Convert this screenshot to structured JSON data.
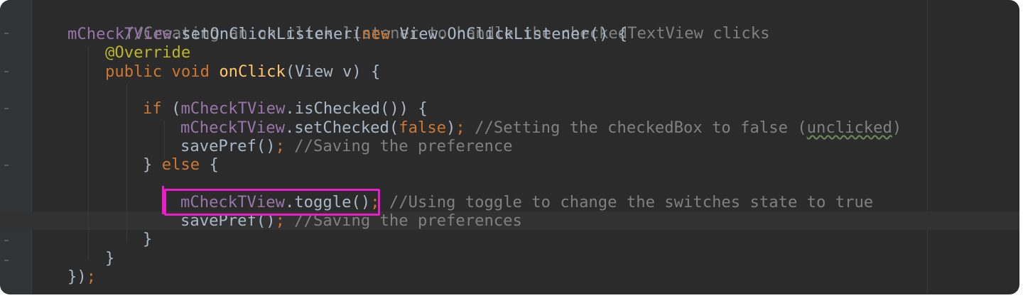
{
  "editor": {
    "theme_colors": {
      "background": "#2b2b2b",
      "gutter": "#313335",
      "comment": "#808080",
      "field": "#9876aa",
      "keyword": "#cc7832",
      "annotation": "#bbb529",
      "method_declaration": "#ffc66d",
      "default_text": "#a9b7c6",
      "highlight_box": "#e91ec8"
    },
    "current_line_number": 12,
    "highlighted_statement": "mCheckTView.toggle();",
    "lines": [
      {
        "comment": "//Creating an on click listener to handle the checkedTextView clicks"
      },
      {
        "field": "mCheckTView",
        "before_kw": ".setOnClickListener(",
        "kw": "new",
        "after_kw": " View.OnClickListener() {"
      },
      {
        "annotation": "@Override"
      },
      {
        "kw": "public void",
        "method": "onClick",
        "rest": "(View v) {"
      },
      {},
      {
        "kw": "if",
        "paren": " (",
        "field": "mCheckTView",
        "rest": ".isChecked()) {"
      },
      {
        "field": "mCheckTView",
        "call": ".setChecked(",
        "kw": "false",
        "close": ")",
        "semi": ";",
        "comment_a": " //Setting the checkedBox to false (",
        "comment_typo": "unclicked",
        "comment_b": ")"
      },
      {
        "call": "savePref()",
        "semi": ";",
        "comment": " //Saving the preference"
      },
      {
        "brace": "} ",
        "kw": "else",
        "rest": " {"
      },
      {},
      {
        "field": "mCheckTView",
        "call": ".toggle()",
        "semi": ";",
        "comment": " //Using toggle to change the switches state to true"
      },
      {
        "call": "savePref()",
        "semi": ";",
        "comment": " //Saving the preferences"
      },
      {
        "text": "}"
      },
      {
        "text": "}"
      },
      {
        "text": "})",
        "semi": ";"
      }
    ]
  }
}
